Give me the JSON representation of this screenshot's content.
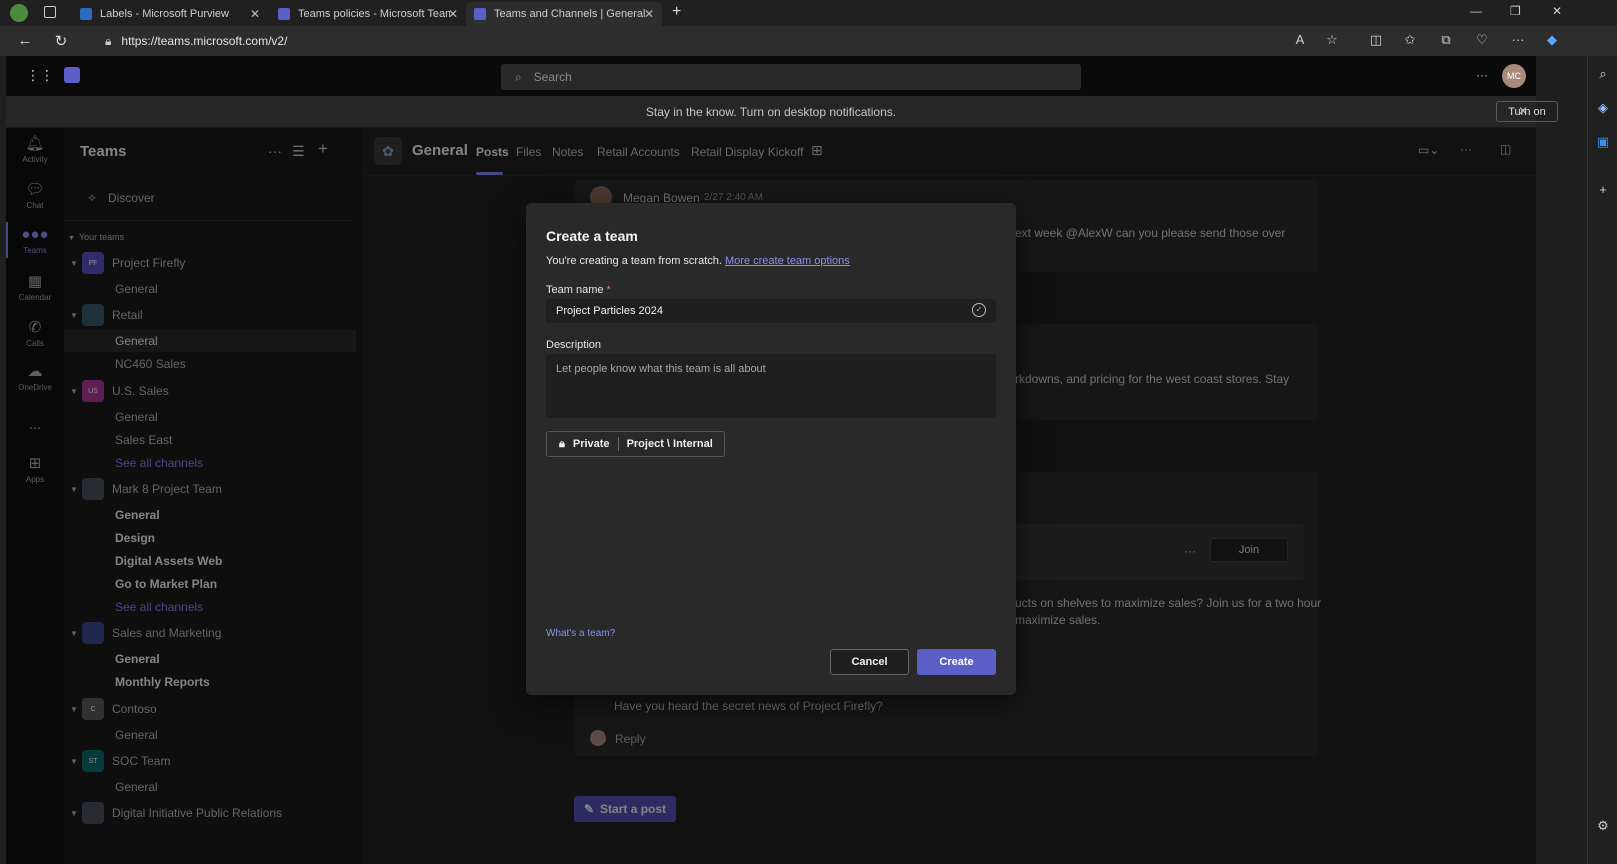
{
  "browser": {
    "tabs": [
      {
        "label": "Labels - Microsoft Purview",
        "active": false
      },
      {
        "label": "Teams policies - Microsoft Teams",
        "active": false
      },
      {
        "label": "Teams and Channels | General | M",
        "active": true
      }
    ],
    "new_tab": "+",
    "url": "https://teams.microsoft.com/v2/"
  },
  "teams_header": {
    "search_placeholder": "Search",
    "avatar_initials": "MC"
  },
  "notification": {
    "text": "Stay in the know. Turn on desktop notifications.",
    "turn_on_label": "Turn on"
  },
  "rail": [
    {
      "label": "Activity",
      "icon": "bell-icon"
    },
    {
      "label": "Chat",
      "icon": "chat-icon"
    },
    {
      "label": "Teams",
      "icon": "teams-icon",
      "active": true
    },
    {
      "label": "Calendar",
      "icon": "calendar-icon"
    },
    {
      "label": "Calls",
      "icon": "phone-icon"
    },
    {
      "label": "OneDrive",
      "icon": "cloud-icon"
    },
    {
      "label": "...",
      "icon": "more-icon"
    },
    {
      "label": "Apps",
      "icon": "apps-icon"
    }
  ],
  "teams_pane": {
    "title": "Teams",
    "discover": "Discover",
    "your_teams": "Your teams",
    "teams": [
      {
        "name": "Project Firefly",
        "initials": "PF",
        "color": "#5b4fc4",
        "channels": [
          {
            "name": "General",
            "style": "normal"
          }
        ]
      },
      {
        "name": "Retail",
        "initials": "",
        "color": "#3a5a6a",
        "channels": [
          {
            "name": "General",
            "style": "selected"
          },
          {
            "name": "NC460 Sales",
            "style": "normal"
          }
        ]
      },
      {
        "name": "U.S. Sales",
        "initials": "US",
        "color": "#b0359a",
        "channels": [
          {
            "name": "General",
            "style": "normal"
          },
          {
            "name": "Sales East",
            "style": "normal"
          },
          {
            "name": "See all channels",
            "style": "link"
          }
        ]
      },
      {
        "name": "Mark 8 Project Team",
        "initials": "",
        "color": "#4a4f5a",
        "channels": [
          {
            "name": "General",
            "style": "bold"
          },
          {
            "name": "Design",
            "style": "bold"
          },
          {
            "name": "Digital Assets Web",
            "style": "bold"
          },
          {
            "name": "Go to Market Plan",
            "style": "bold"
          },
          {
            "name": "See all channels",
            "style": "link"
          }
        ]
      },
      {
        "name": "Sales and Marketing",
        "initials": "",
        "color": "#3a4a8a",
        "channels": [
          {
            "name": "General",
            "style": "bold"
          },
          {
            "name": "Monthly Reports",
            "style": "bold"
          }
        ]
      },
      {
        "name": "Contoso",
        "initials": "C",
        "color": "#5a5a5a",
        "channels": [
          {
            "name": "General",
            "style": "normal"
          }
        ]
      },
      {
        "name": "SOC Team",
        "initials": "ST",
        "color": "#0e6b6b",
        "channels": [
          {
            "name": "General",
            "style": "normal"
          }
        ]
      },
      {
        "name": "Digital Initiative Public Relations",
        "initials": "",
        "color": "#4a4f5a",
        "channels": []
      }
    ]
  },
  "channel": {
    "name": "General",
    "tabs": [
      "Posts",
      "Files",
      "Notes",
      "Retail Accounts",
      "Retail Display Kickoff"
    ]
  },
  "feed": {
    "author": "Megan Bowen",
    "time": "2/27 2:40 AM",
    "line1": "ext week @AlexW can you please send those over",
    "line2": "rkdowns, and pricing for the west coast stores. Stay",
    "join_label": "Join",
    "line3": "ucts on shelves to maximize sales? Join us for a two hour",
    "line4": "maximize sales.",
    "line5": "Have you heard the secret news of Project Firefly?",
    "reply": "Reply",
    "start_post": "Start a post"
  },
  "modal": {
    "title": "Create a team",
    "subtitle": "You're creating a team from scratch.",
    "subtitle_link": "More create team options",
    "team_name_label": "Team name",
    "required_mark": "*",
    "team_name_value": "Project Particles 2024",
    "description_label": "Description",
    "description_placeholder": "Let people know what this team is all about",
    "privacy": "Private",
    "sensitivity": "Project \\ Internal",
    "whats_team": "What's a team?",
    "cancel": "Cancel",
    "create": "Create"
  }
}
